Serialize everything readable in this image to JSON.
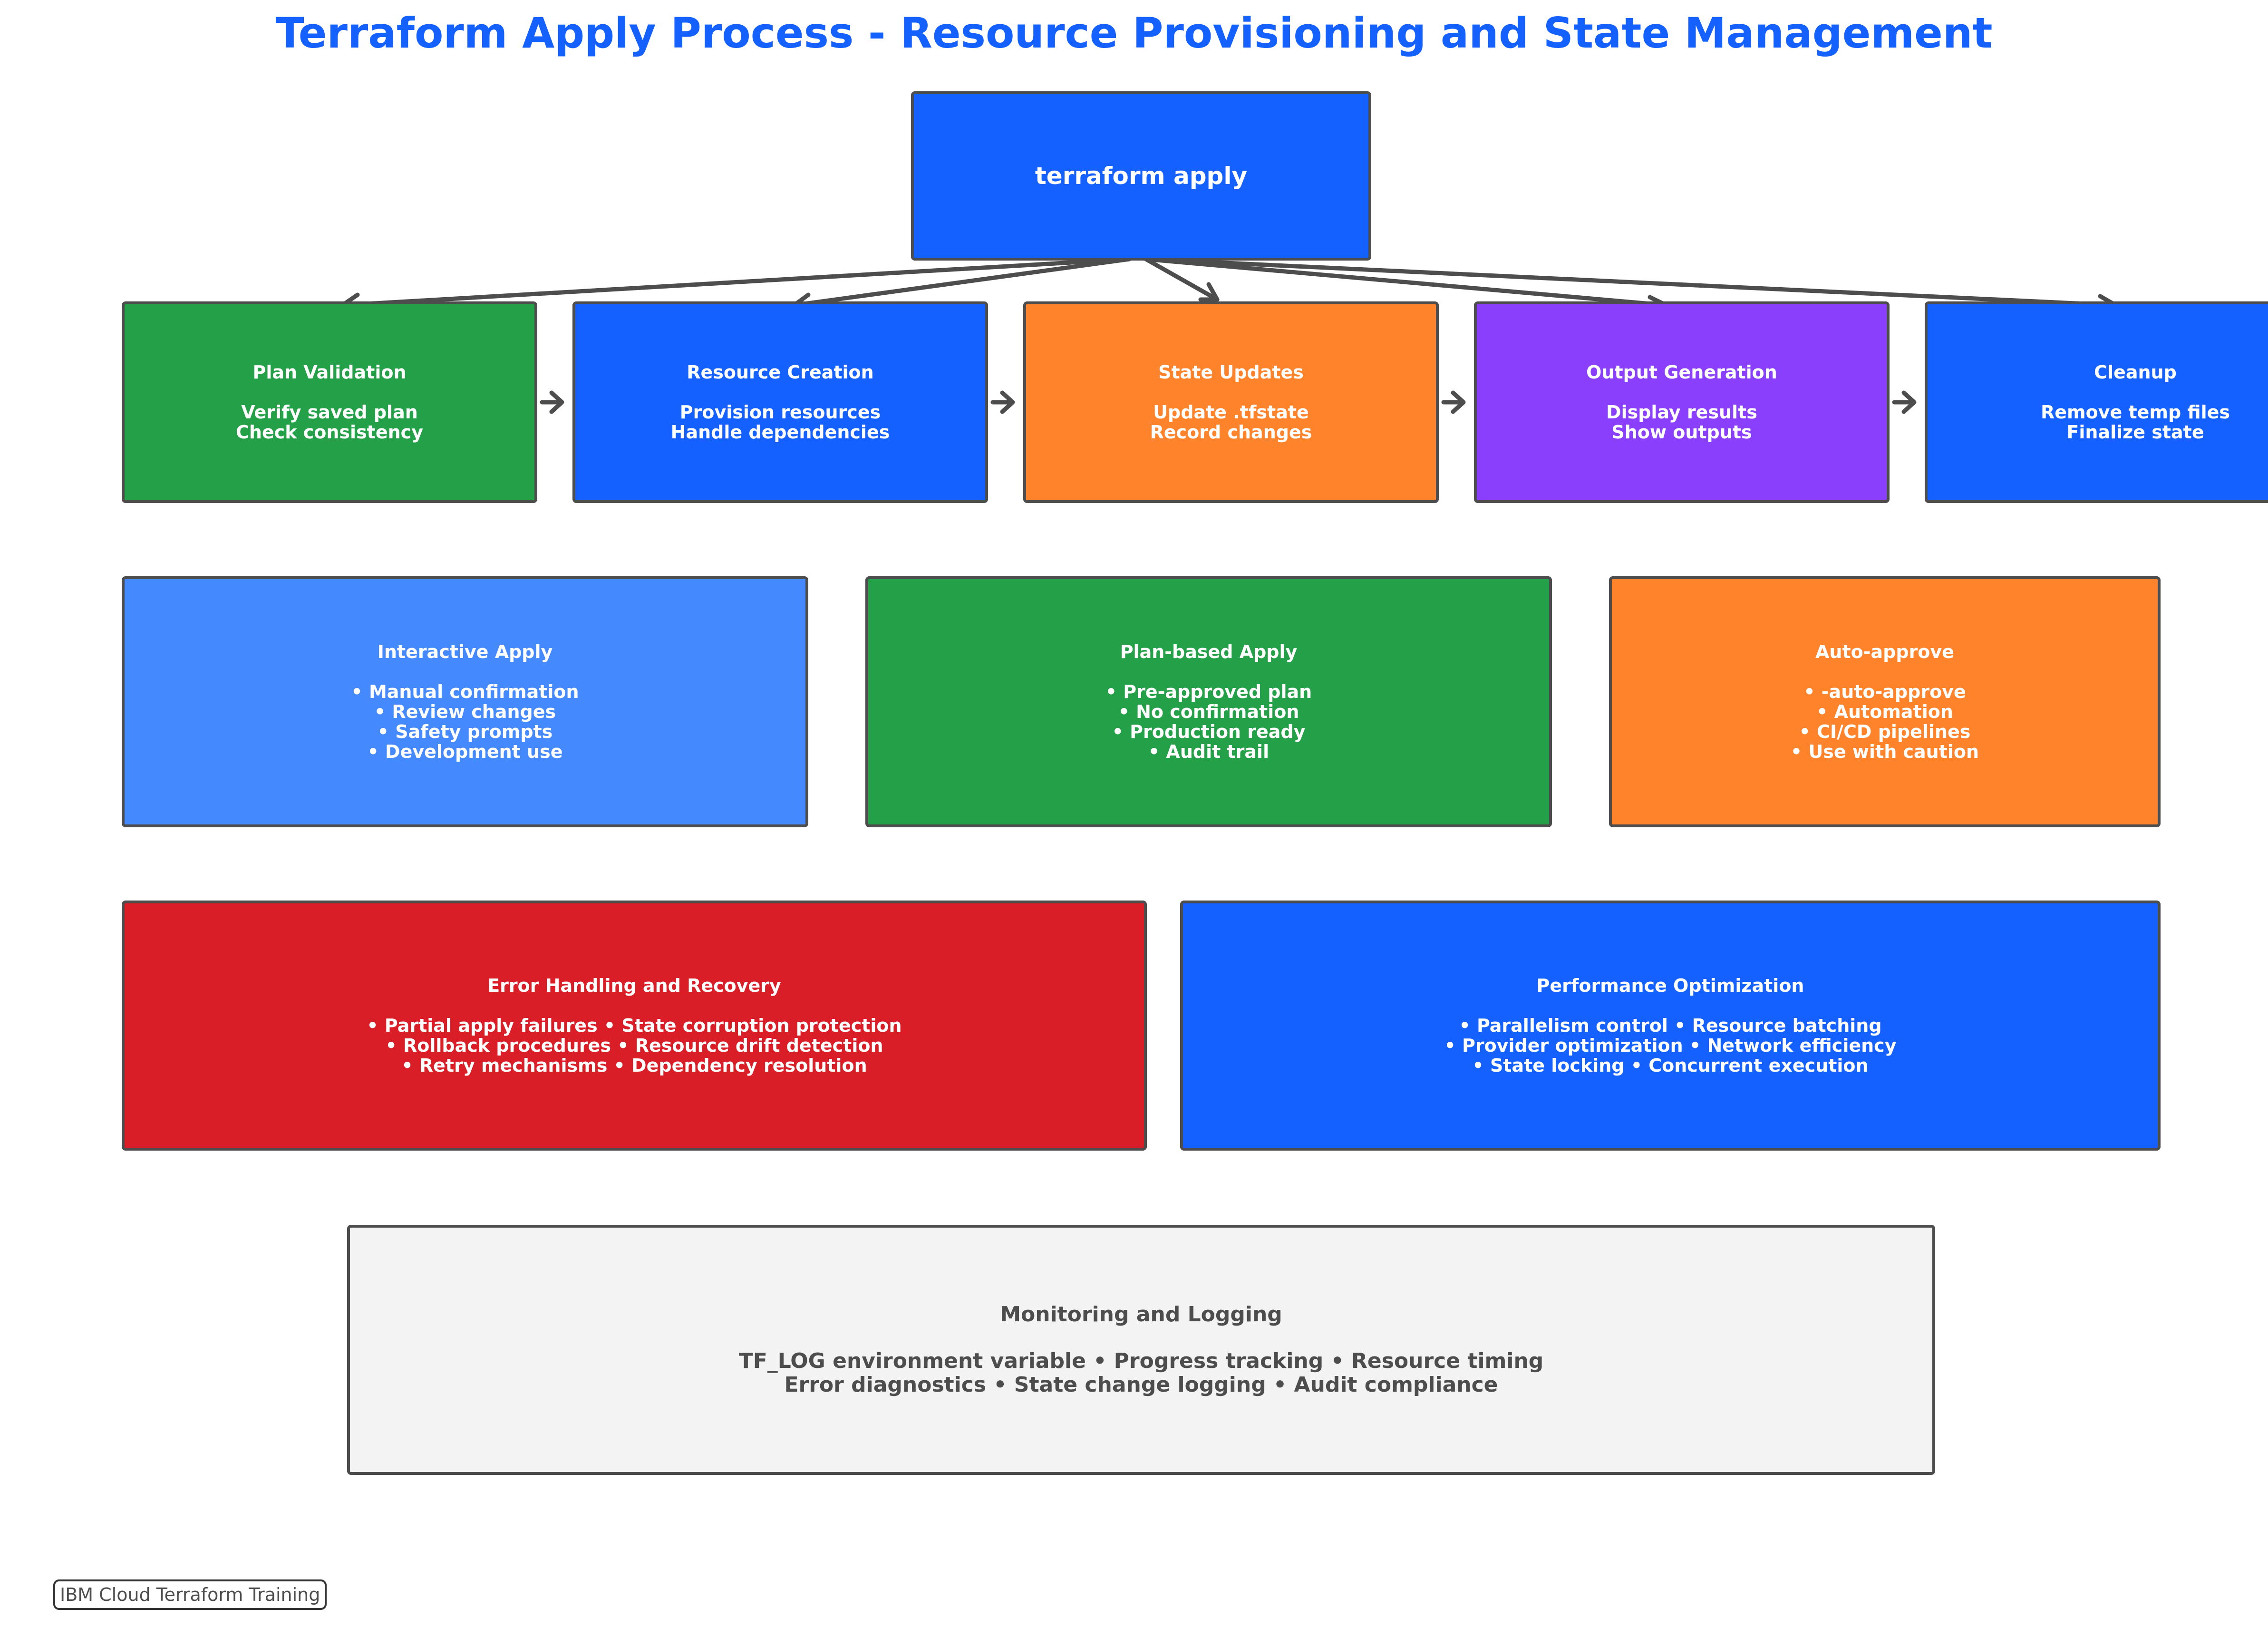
{
  "title": "Terraform Apply Process - Resource Provisioning and State Management",
  "root": {
    "label": "terraform apply",
    "color": "#1461ff"
  },
  "steps": [
    {
      "title": "Plan Validation",
      "lines": [
        "Verify saved plan",
        "Check consistency"
      ],
      "color": "#24a148"
    },
    {
      "title": "Resource Creation",
      "lines": [
        "Provision resources",
        "Handle dependencies"
      ],
      "color": "#1461ff"
    },
    {
      "title": "State Updates",
      "lines": [
        "Update .tfstate",
        "Record changes"
      ],
      "color": "#ff832b"
    },
    {
      "title": "Output Generation",
      "lines": [
        "Display results",
        "Show outputs"
      ],
      "color": "#8a3ffc"
    },
    {
      "title": "Cleanup",
      "lines": [
        "Remove temp files",
        "Finalize state"
      ],
      "color": "#1461ff"
    }
  ],
  "modes": [
    {
      "title": "Interactive Apply",
      "lines": [
        "• Manual confirmation",
        "• Review changes",
        "• Safety prompts",
        "• Development use"
      ],
      "color": "#4589ff"
    },
    {
      "title": "Plan-based Apply",
      "lines": [
        "• Pre-approved plan",
        "• No confirmation",
        "• Production ready",
        "• Audit trail"
      ],
      "color": "#24a148"
    },
    {
      "title": "Auto-approve",
      "lines": [
        "• -auto-approve",
        "• Automation",
        "• CI/CD pipelines",
        "• Use with caution"
      ],
      "color": "#ff832b"
    }
  ],
  "concerns": [
    {
      "title": "Error Handling and Recovery",
      "lines": [
        "• Partial apply failures • State corruption protection",
        "• Rollback procedures • Resource drift detection",
        "• Retry mechanisms • Dependency resolution"
      ],
      "color": "#da1e28"
    },
    {
      "title": "Performance Optimization",
      "lines": [
        "• Parallelism control • Resource batching",
        "• Provider optimization • Network efficiency",
        "• State locking • Concurrent execution"
      ],
      "color": "#1461ff"
    }
  ],
  "monitoring": {
    "title": "Monitoring and Logging",
    "lines": [
      "TF_LOG environment variable • Progress tracking • Resource timing",
      "Error diagnostics • State change logging • Audit compliance"
    ],
    "color": "#f3f3f3"
  },
  "footer": "IBM Cloud Terraform Training",
  "colors": {
    "arrow": "#4d4d4d",
    "border": "#4d4d4d",
    "title": "#1461ff"
  }
}
